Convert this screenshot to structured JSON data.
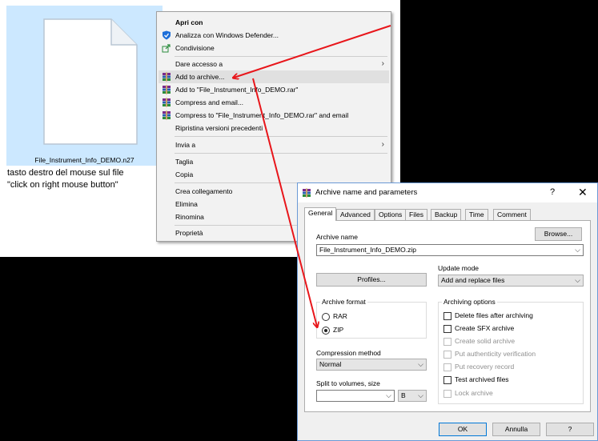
{
  "explorer": {
    "file_name": "File_Instrument_Info_DEMO.n27",
    "caption_line1": "tasto destro del mouse sul file",
    "caption_line2": "\"click on right mouse button\""
  },
  "context_menu": {
    "items": [
      {
        "label": "Apri con",
        "bold": true
      },
      {
        "label": "Analizza con Windows Defender...",
        "icon": "shield-icon"
      },
      {
        "label": "Condivisione",
        "icon": "share-icon"
      },
      {
        "label": "Dare accesso a",
        "submenu": true
      },
      {
        "label": "Add to archive...",
        "icon": "winrar-icon",
        "highlighted": true
      },
      {
        "label": "Add to \"File_Instrument_Info_DEMO.rar\"",
        "icon": "winrar-icon"
      },
      {
        "label": "Compress and email...",
        "icon": "winrar-icon"
      },
      {
        "label": "Compress to \"File_Instrument_Info_DEMO.rar\" and email",
        "icon": "winrar-icon"
      },
      {
        "label": "Ripristina versioni precedenti"
      },
      {
        "label": "Invia a",
        "submenu": true
      },
      {
        "label": "Taglia"
      },
      {
        "label": "Copia"
      },
      {
        "label": "Crea collegamento"
      },
      {
        "label": "Elimina"
      },
      {
        "label": "Rinomina"
      },
      {
        "label": "Proprietà"
      }
    ]
  },
  "dialog": {
    "title": "Archive name and parameters",
    "help_symbol": "?",
    "close_symbol": "✕",
    "tabs": [
      "General",
      "Advanced",
      "Options",
      "Files",
      "Backup",
      "Time",
      "Comment"
    ],
    "archive_name_label": "Archive name",
    "browse_label": "Browse...",
    "archive_name_value": "File_Instrument_Info_DEMO.zip",
    "update_mode_label": "Update mode",
    "update_mode_value": "Add and replace files",
    "profiles_label": "Profiles...",
    "archive_format_label": "Archive format",
    "format_rar": "RAR",
    "format_zip": "ZIP",
    "selected_format": "ZIP",
    "archiving_options_label": "Archiving options",
    "options": [
      {
        "label": "Delete files after archiving",
        "checked": false,
        "disabled": false
      },
      {
        "label": "Create SFX archive",
        "checked": false,
        "disabled": false
      },
      {
        "label": "Create solid archive",
        "checked": false,
        "disabled": true
      },
      {
        "label": "Put authenticity verification",
        "checked": false,
        "disabled": true
      },
      {
        "label": "Put recovery record",
        "checked": false,
        "disabled": true
      },
      {
        "label": "Test archived files",
        "checked": false,
        "disabled": false
      },
      {
        "label": "Lock archive",
        "checked": false,
        "disabled": true
      }
    ],
    "compression_method_label": "Compression method",
    "compression_method_value": "Normal",
    "split_label": "Split to volumes, size",
    "split_value": "",
    "split_unit": "B",
    "ok_label": "OK",
    "cancel_label": "Annulla",
    "help_label": "?"
  },
  "colors": {
    "annotation_arrow": "#e8161b",
    "selection": "#cce8ff",
    "menu_highlight": "#e0e0e0"
  }
}
